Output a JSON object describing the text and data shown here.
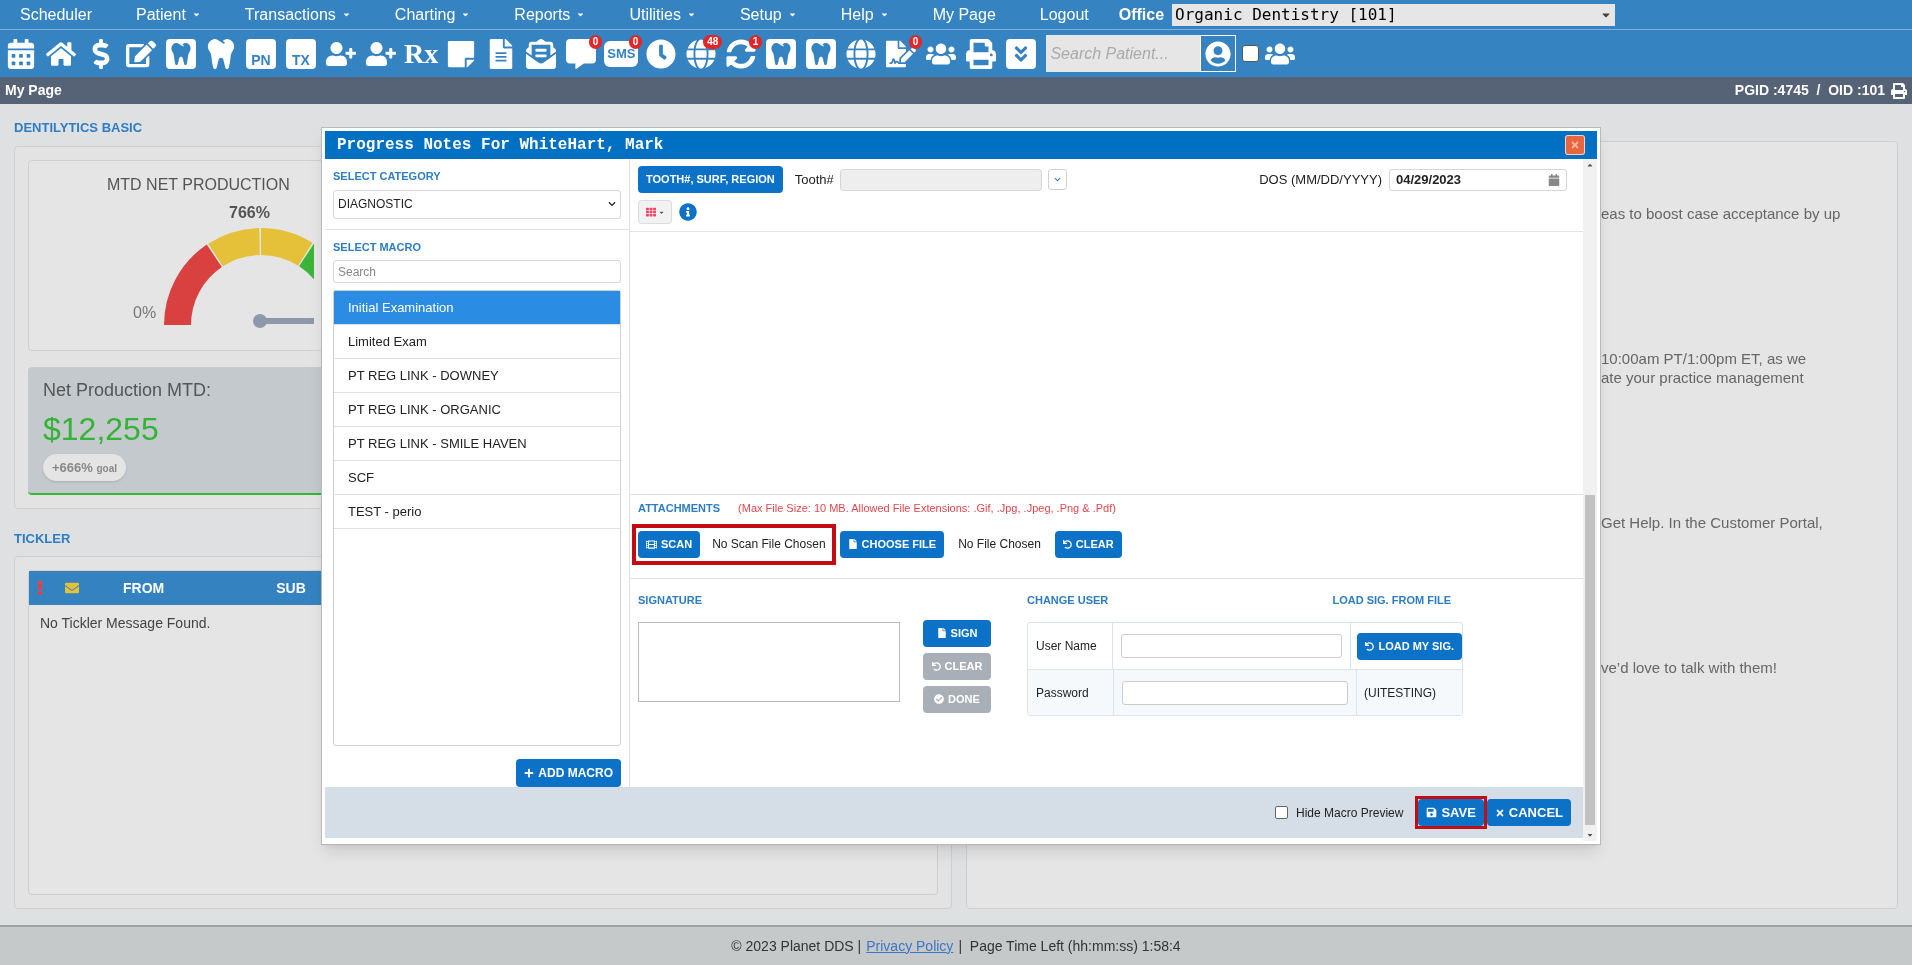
{
  "menu": [
    {
      "label": "Scheduler",
      "dropdown": false
    },
    {
      "label": "Patient",
      "dropdown": true
    },
    {
      "label": "Transactions",
      "dropdown": true
    },
    {
      "label": "Charting",
      "dropdown": true
    },
    {
      "label": "Reports",
      "dropdown": true
    },
    {
      "label": "Utilities",
      "dropdown": true
    },
    {
      "label": "Setup",
      "dropdown": true
    },
    {
      "label": "Help",
      "dropdown": true
    },
    {
      "label": "My Page",
      "dropdown": false
    },
    {
      "label": "Logout",
      "dropdown": false
    }
  ],
  "office": {
    "label": "Office",
    "value": "Organic Dentistry [101]"
  },
  "toolbar": [
    {
      "kind": "calendar"
    },
    {
      "kind": "home"
    },
    {
      "kind": "dollar"
    },
    {
      "kind": "edit"
    },
    {
      "kind": "tooth-box"
    },
    {
      "kind": "tooth"
    },
    {
      "kind": "text-box",
      "text": "PN"
    },
    {
      "kind": "text-box",
      "text": "TX"
    },
    {
      "kind": "user-plus"
    },
    {
      "kind": "user-plus"
    },
    {
      "kind": "text",
      "text": "Rx"
    },
    {
      "kind": "note"
    },
    {
      "kind": "document"
    },
    {
      "kind": "envelope"
    },
    {
      "kind": "chat",
      "badge": "0"
    },
    {
      "kind": "bubble-text",
      "text": "SMS",
      "badge": "0"
    },
    {
      "kind": "clock"
    },
    {
      "kind": "globe",
      "badge": "48"
    },
    {
      "kind": "sync",
      "badge": "1"
    },
    {
      "kind": "tooth-box"
    },
    {
      "kind": "tooth-box"
    },
    {
      "kind": "globe"
    },
    {
      "kind": "document-check",
      "badge": "0"
    },
    {
      "kind": "users"
    },
    {
      "kind": "printer"
    },
    {
      "kind": "double-down"
    }
  ],
  "patient_search": {
    "placeholder": "Search Patient...",
    "include_inactive": false
  },
  "page_bar": {
    "title": "My Page",
    "ids": "PGID :4745  /  OID :101"
  },
  "dentilytics": {
    "heading": "DENTILYTICS BASIC",
    "gauge_title": "MTD NET PRODUCTION",
    "gauge_value": "766%",
    "gauge_min": "0%",
    "net_label": "Net Production MTD:",
    "net_value": "$12,255",
    "goal_value": "+666%",
    "goal_label": "goal"
  },
  "tickler": {
    "heading": "TICKLER",
    "columns": [
      "FROM",
      "SUB"
    ],
    "empty": "No Tickler Message Found."
  },
  "announcements": {
    "lines": [
      [
        "eas to boost case acceptance by up"
      ],
      [
        "10:00am PT/1:00pm ET, as we",
        "ate your practice management"
      ],
      [
        "Get Help. In the Customer Portal,"
      ],
      [
        "ve’d love to talk with them!"
      ]
    ]
  },
  "modal": {
    "title": "Progress Notes For WhiteHart, Mark",
    "category_label": "SELECT CATEGORY",
    "category": "DIAGNOSTIC",
    "macro_label": "SELECT MACRO",
    "macro_search_placeholder": "Search",
    "macros": [
      {
        "label": "Initial Examination",
        "selected": true
      },
      {
        "label": "Limited Exam",
        "selected": false
      },
      {
        "label": "PT REG LINK - DOWNEY",
        "selected": false
      },
      {
        "label": "PT REG LINK - ORGANIC",
        "selected": false
      },
      {
        "label": "PT REG LINK - SMILE HAVEN",
        "selected": false
      },
      {
        "label": "SCF",
        "selected": false
      },
      {
        "label": "TEST - perio",
        "selected": false
      }
    ],
    "add_macro": "ADD MACRO",
    "tooth_button": "TOOTH#, SURF, REGION",
    "tooth_label": "Tooth#",
    "dos_label": "DOS (MM/DD/YYYY)",
    "dos_value": "04/29/2023",
    "attachments_label": "ATTACHMENTS",
    "attachments_note": "(Max File Size: 10 MB. Allowed File Extensions: .Gif, .Jpg, .Jpeg, .Png & .Pdf)",
    "scan": {
      "button": "SCAN",
      "status": "No Scan File Chosen",
      "highlight": true
    },
    "choose_file": "CHOOSE FILE",
    "file_status": "No File Chosen",
    "clear_files": "CLEAR",
    "signature_label": "SIGNATURE",
    "sign_buttons": [
      {
        "label": "SIGN",
        "kind": "file",
        "disabled": false
      },
      {
        "label": "CLEAR",
        "kind": "undo",
        "disabled": true
      },
      {
        "label": "DONE",
        "kind": "check",
        "disabled": true
      }
    ],
    "change_user_label": "CHANGE USER",
    "load_sig_file": "LOAD SIG. FROM FILE",
    "user_name_label": "User Name",
    "password_label": "Password",
    "load_my_sig": "LOAD MY SIG.",
    "user_code": "(UITESTING)",
    "hide_preview": {
      "label": "Hide Macro Preview",
      "checked": false
    },
    "save": {
      "label": "SAVE",
      "highlight": true
    },
    "cancel": "CANCEL"
  },
  "footer": {
    "copyright": "© 2023 Planet DDS |",
    "link": "Privacy Policy",
    "time": "|  Page Time Left (hh:mm:ss) 1:58:4"
  }
}
